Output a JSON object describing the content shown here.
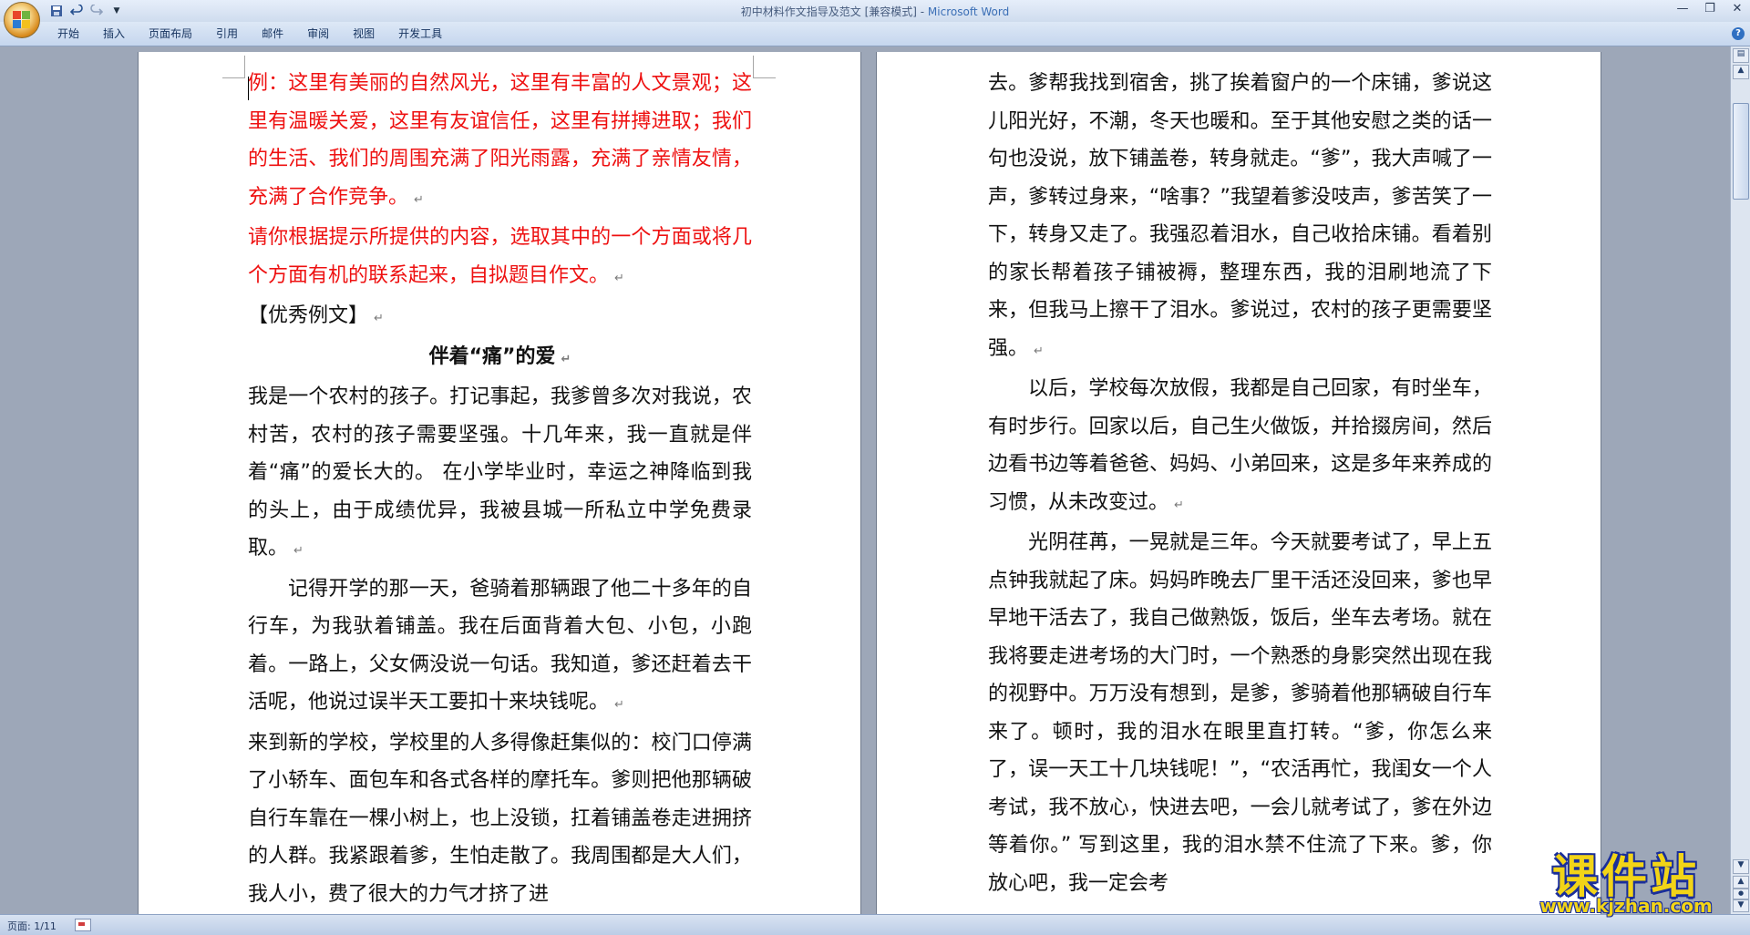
{
  "window": {
    "title": "初中材料作文指导及范文 [兼容模式] - ",
    "app_name": "Microsoft Word",
    "controls": [
      "minimize",
      "maximize",
      "close"
    ]
  },
  "quick_access": {
    "save_icon": "save-icon",
    "undo_icon": "undo-icon",
    "redo_icon": "redo-icon",
    "customize_icon": "dropdown-icon"
  },
  "ribbon": {
    "tabs": [
      "开始",
      "插入",
      "页面布局",
      "引用",
      "邮件",
      "审阅",
      "视图",
      "开发工具"
    ],
    "help": "?"
  },
  "document": {
    "left_page": [
      {
        "text": "例：这里有美丽的自然风光，这里有丰富的人文景观；这里有温暖关爱，这里有友谊信任，这里有拼搏进取；我们的生活、我们的周围充满了阳光雨露，充满了亲情友情，充满了合作竞争。",
        "style": "red"
      },
      {
        "text": "请你根据提示所提供的内容，选取其中的一个方面或将几个方面有机的联系起来，自拟题目作文。",
        "style": "red"
      },
      {
        "text": "【优秀例文】",
        "style": "normal"
      },
      {
        "text": "伴着“痛”的爱",
        "style": "center"
      },
      {
        "text": "我是一个农村的孩子。打记事起，我爹曾多次对我说，农村苦，农村的孩子需要坚强。十几年来，我一直就是伴着“痛”的爱长大的。 在小学毕业时，幸运之神降临到我的头上，由于成绩优异，我被县城一所私立中学免费录取。",
        "style": "normal"
      },
      {
        "text": "记得开学的那一天，爸骑着那辆跟了他二十多年的自行车，为我驮着铺盖。我在后面背着大包、小包，小跑着。一路上，父女俩没说一句话。我知道，爹还赶着去干活呢，他说过误半天工要扣十来块钱呢。",
        "style": "indent"
      },
      {
        "text": "来到新的学校，学校里的人多得像赶集似的：校门口停满了小轿车、面包车和各式各样的摩托车。爹则把他那辆破自行车靠在一棵小树上，也上没锁，扛着铺盖卷走进拥挤的人群。我紧跟着爹，生怕走散了。我周围都是大人们，我人小，费了很大的力气才挤了进",
        "style": "normal"
      }
    ],
    "right_page": [
      {
        "text": "去。爹帮我找到宿舍，挑了挨着窗户的一个床铺，爹说这儿阳光好，不潮，冬天也暖和。至于其他安慰之类的话一句也没说，放下铺盖卷，转身就走。“爹”，我大声喊了一声，爹转过身来，“啥事？”我望着爹没吱声，爹苦笑了一下，转身又走了。我强忍着泪水，自己收拾床铺。看着别的家长帮着孩子铺被褥，整理东西，我的泪刷地流了下来，但我马上擦干了泪水。爹说过，农村的孩子更需要坚强。",
        "style": "normal"
      },
      {
        "text": "以后，学校每次放假，我都是自己回家，有时坐车，有时步行。回家以后，自己生火做饭，并拾掇房间，然后边看书边等着爸爸、妈妈、小弟回来，这是多年来养成的习惯，从未改变过。",
        "style": "indent"
      },
      {
        "text": "光阴荏苒，一晃就是三年。今天就要考试了，早上五点钟我就起了床。妈妈昨晚去厂里干活还没回来，爹也早早地干活去了，我自己做熟饭，饭后，坐车去考场。就在我将要走进考场的大门时，一个熟悉的身影突然出现在我的视野中。万万没有想到，是爹，爹骑着他那辆破自行车来了。顿时，我的泪水在眼里直打转。“爹，你怎么来了，误一天工十几块钱呢！”，“农活再忙，我闺女一个人考试，我不放心，快进去吧，一会儿就考试了，爹在外边等着你。” 写到这里，我的泪水禁不住流了下来。爹，你放心吧，我一定会考",
        "style": "indent"
      }
    ],
    "paragraph_mark": "↵"
  },
  "status": {
    "page_count": "页面: 1/11"
  },
  "watermark": {
    "main": "课件站",
    "url": "www.kjzhan.com"
  },
  "colors": {
    "red_text": "#ee1111",
    "title_app": "#3b6fb6",
    "background": "#9da7b8"
  }
}
